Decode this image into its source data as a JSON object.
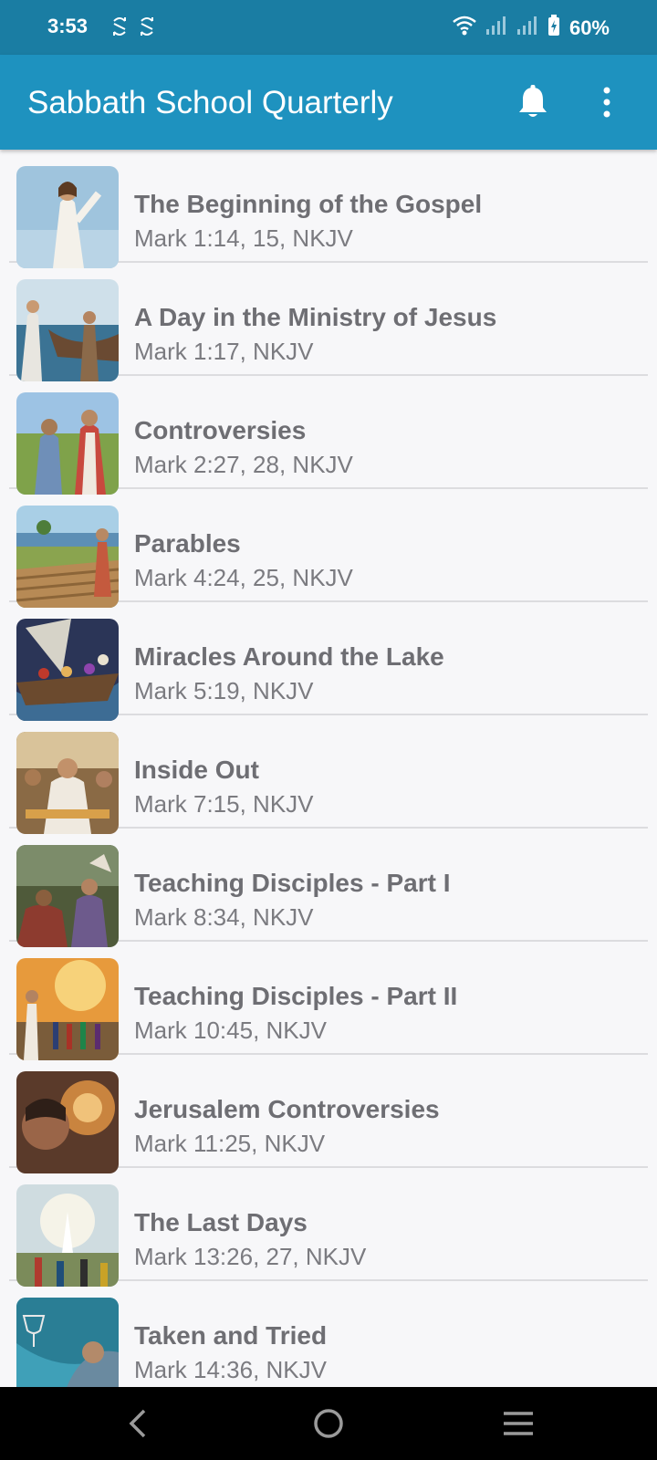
{
  "status_bar": {
    "time": "3:53",
    "battery": "60%",
    "icons": [
      "sync-icon",
      "sync-icon",
      "wifi-icon",
      "signal-icon",
      "signal-icon",
      "battery-icon"
    ]
  },
  "app_bar": {
    "title": "Sabbath School Quarterly",
    "icons": [
      "bell-icon",
      "more-vert-icon"
    ]
  },
  "lessons": [
    {
      "title": "The Beginning of the Gospel",
      "subtitle": "Mark 1:14, 15, NKJV"
    },
    {
      "title": "A Day in the Ministry of Jesus",
      "subtitle": "Mark 1:17, NKJV"
    },
    {
      "title": "Controversies",
      "subtitle": "Mark 2:27, 28, NKJV"
    },
    {
      "title": "Parables",
      "subtitle": "Mark 4:24, 25, NKJV"
    },
    {
      "title": "Miracles Around the Lake",
      "subtitle": "Mark 5:19, NKJV"
    },
    {
      "title": "Inside Out",
      "subtitle": "Mark 7:15, NKJV"
    },
    {
      "title": "Teaching Disciples - Part I",
      "subtitle": "Mark 8:34, NKJV"
    },
    {
      "title": "Teaching Disciples - Part II",
      "subtitle": "Mark 10:45, NKJV"
    },
    {
      "title": "Jerusalem Controversies",
      "subtitle": "Mark 11:25, NKJV"
    },
    {
      "title": "The Last Days",
      "subtitle": "Mark 13:26, 27, NKJV"
    },
    {
      "title": "Taken and Tried",
      "subtitle": "Mark 14:36, NKJV"
    }
  ],
  "nav_bar": {
    "icons": [
      "back-icon",
      "home-icon",
      "recents-icon"
    ]
  },
  "colors": {
    "status_bar": "#1a7da3",
    "app_bar": "#1e92bf",
    "background": "#f7f7f9",
    "text_title": "#6e6e73",
    "text_subtitle": "#7b7b80"
  }
}
